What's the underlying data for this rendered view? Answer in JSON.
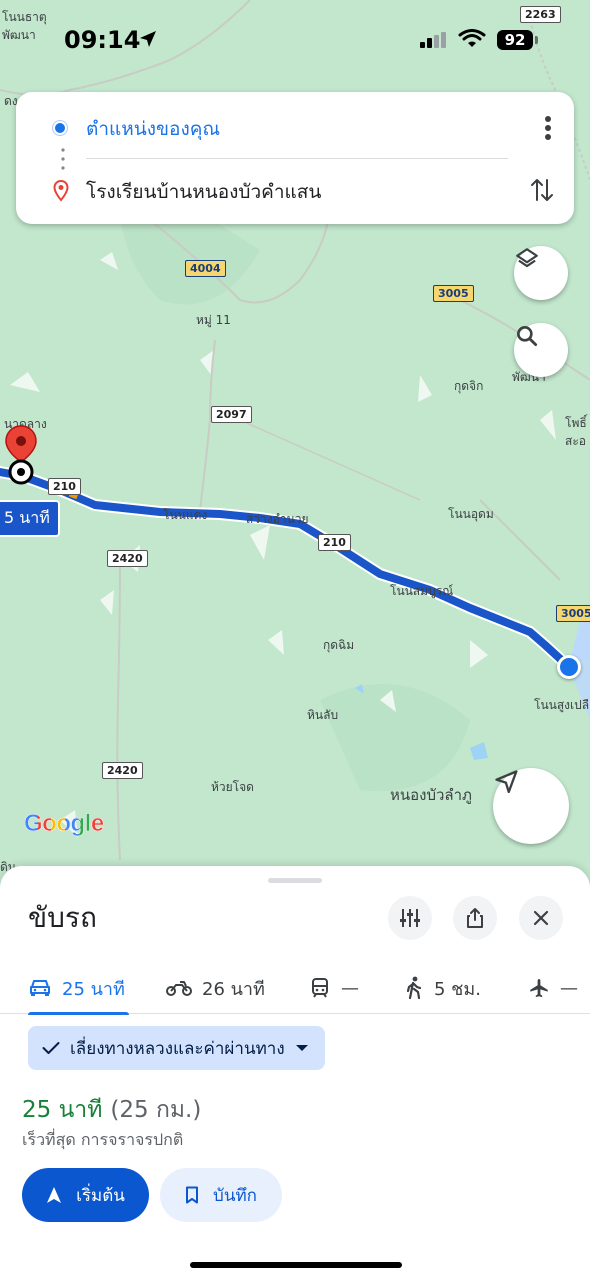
{
  "status_bar": {
    "time": "09:14",
    "battery": "92"
  },
  "directions": {
    "origin": "ตำแหน่งของคุณ",
    "destination": "โรงเรียนบ้านหนองบัวคำแสน"
  },
  "map": {
    "place_labels": [
      "โนนธาตุ",
      "พัฒนา",
      "ดงธ",
      "หมู่ 11",
      "กุดจิก",
      "พัฒนา",
      "โพธิ์",
      "สะอ",
      "นาอ่อน",
      "นาดลาง",
      "โนนแดง",
      "สว่างอำนวย",
      "โนนอุดม",
      "โนนสมบูรณ์",
      "กุดฉิม",
      "หินลับ",
      "ห้วยโจด",
      "โนนสูงเปลือย",
      "หนองบัวลำภู",
      "ดิน"
    ],
    "road_shields": [
      "2263",
      "4004",
      "3005",
      "2097",
      "210",
      "210",
      "2420",
      "2420",
      "3005"
    ],
    "duration_callout": "5 นาที",
    "logo": "Google"
  },
  "sheet": {
    "title": "ขับรถ",
    "modes": [
      {
        "label": "25 นาที",
        "icon": "car-icon"
      },
      {
        "label": "26 นาที",
        "icon": "motorcycle-icon"
      },
      {
        "label": "—",
        "icon": "transit-icon"
      },
      {
        "label": "5 ชม.",
        "icon": "walk-icon"
      },
      {
        "label": "—",
        "icon": "flight-icon"
      }
    ],
    "chip": "เลี่ยงทางหลวงและค่าผ่านทาง",
    "route_time": "25 นาที",
    "route_distance": "(25 กม.)",
    "route_sub": "เร็วที่สุด การจราจรปกติ",
    "start_label": "เริ่มต้น",
    "save_label": "บันทึก"
  },
  "colors": {
    "route": "#1a56c9",
    "accent": "#1a73e8",
    "time_green": "#188038",
    "pin": "#ea4335"
  }
}
